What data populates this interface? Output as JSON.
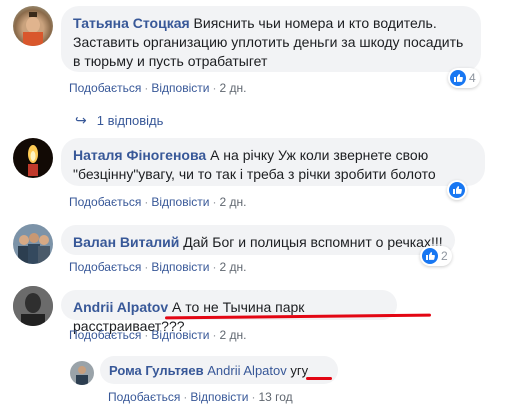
{
  "comments": [
    {
      "author": "Татьяна Стоцкая",
      "text": "Вияснить чьи номера и кто водитель. Заставить организацию уплотить деньги за шкоду посадить в тюрьму и пусть отрабатыгет",
      "like": "Подобається",
      "reply": "Відповісти",
      "time": "2 дн.",
      "reactions": "4",
      "replies": "1 відповідь"
    },
    {
      "author": "Наталя Фіногенова",
      "text": "А на річку Уж коли звернете свою \"безцінну\"увагу, чи то так і треба з річки зробити болото",
      "like": "Подобається",
      "reply": "Відповісти",
      "time": "2 дн.",
      "reactions": ""
    },
    {
      "author": "Валан Виталий",
      "text": "Дай Бог и полицыя вспомнит о речках!!!",
      "like": "Подобається",
      "reply": "Відповісти",
      "time": "2 дн.",
      "reactions": "2"
    },
    {
      "author": "Andrii Alpatov",
      "text": "А то не Тычина парк расстраивает???",
      "like": "Подобається",
      "reply": "Відповісти",
      "time": "2 дн."
    }
  ],
  "reply": {
    "author": "Рома Гультяев",
    "mention": "Andrii Alpatov",
    "text": "угу",
    "like": "Подобається",
    "reply": "Відповісти",
    "time": "13 год"
  },
  "colors": {
    "link": "#385898",
    "bubble": "#f2f3f5",
    "like_badge": "#1877f2",
    "annotation": "#e30613"
  }
}
